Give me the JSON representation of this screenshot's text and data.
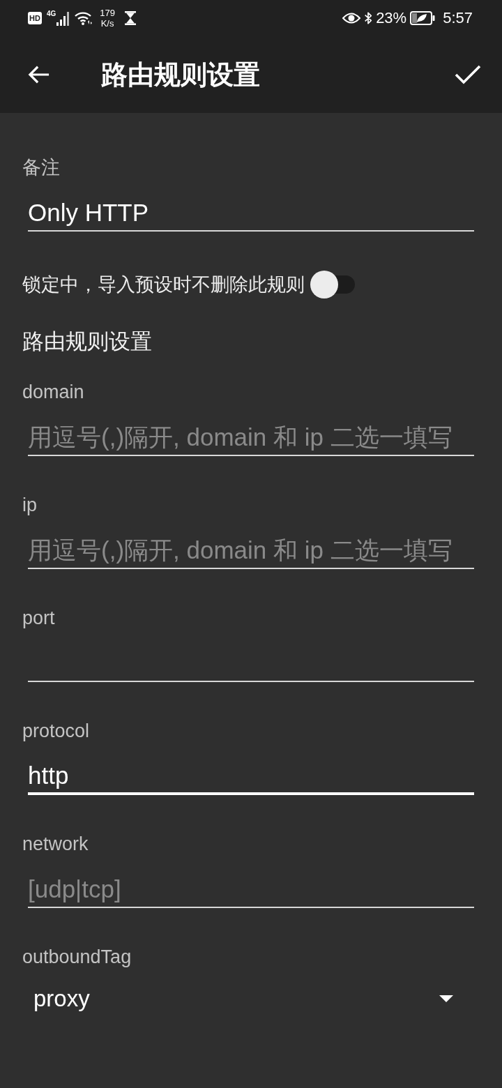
{
  "status_bar": {
    "hd_badge": "HD",
    "network_type": "4G",
    "speed_value": "179",
    "speed_unit": "K/s",
    "battery": "23%",
    "time": "5:57"
  },
  "toolbar": {
    "title": "路由规则设置"
  },
  "remarks": {
    "label": "备注",
    "value": "Only HTTP",
    "focused": false
  },
  "lock": {
    "label": "锁定中，导入预设时不删除此规则",
    "on": false
  },
  "section_title": "路由规则设置",
  "fields": [
    {
      "label": "domain",
      "placeholder": "用逗号(,)隔开, domain 和 ip 二选一填写",
      "focused": false
    },
    {
      "label": "ip",
      "placeholder": "用逗号(,)隔开, domain 和 ip 二选一填写",
      "focused": false
    },
    {
      "label": "port",
      "focused": false
    },
    {
      "label": "protocol",
      "value": "http",
      "focused": true
    },
    {
      "label": "network",
      "placeholder": "[udp|tcp]",
      "focused": false
    }
  ],
  "outbound": {
    "label": "outboundTag",
    "value": "proxy"
  }
}
